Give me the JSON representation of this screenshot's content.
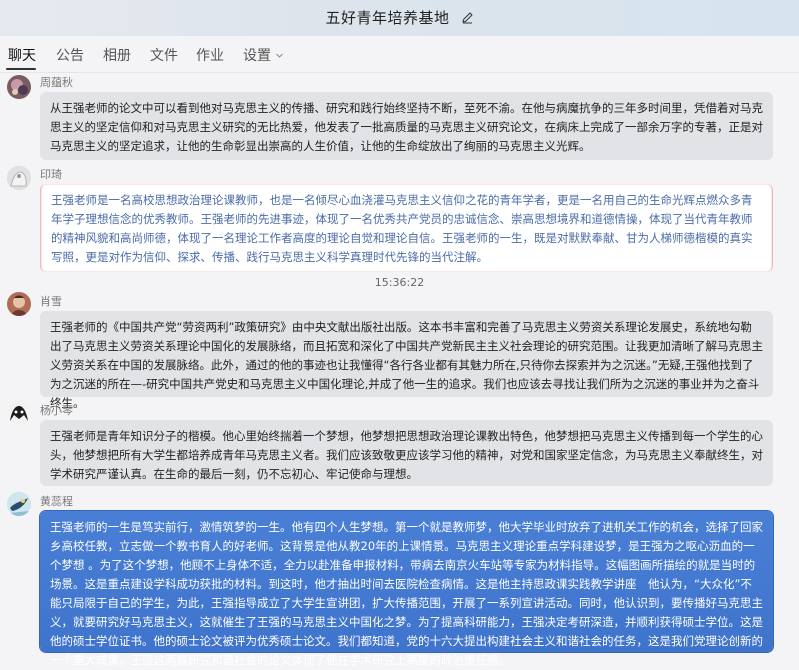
{
  "header": {
    "title": "五好青年培养基地"
  },
  "tabs": [
    {
      "label": "聊天",
      "active": true
    },
    {
      "label": "公告",
      "active": false
    },
    {
      "label": "相册",
      "active": false
    },
    {
      "label": "文件",
      "active": false
    },
    {
      "label": "作业",
      "active": false
    },
    {
      "label": "设置",
      "active": false
    }
  ],
  "messages": [
    {
      "name": "周蕴秋",
      "text": "从王强老师的论文中可以看到他对马克思主义的传播、研究和践行始终坚持不断，至死不渝。在他与病魔抗争的三年多时间里，凭借着对马克思主义的坚定信仰和对马克思主义研究的无比热爱，他发表了一批高质量的马克思主义研究论文，在病床上完成了一部余万字的专著，正是对马克思主义的坚定追求，让他的生命彰显出崇高的人生价值，让他的生命绽放出了绚丽的马克思主义光辉。"
    },
    {
      "name": "印琦",
      "text": "王强老师是一名高校思想政治理论课教师，也是一名倾尽心血浇灌马克思主义信仰之花的青年学者，更是一名用自己的生命光辉点燃众多青年学子理想信念的优秀教师。王强老师的先进事迹，体现了一名优秀共产党员的忠诚信念、崇高思想境界和道德情操，体现了当代青年教师的精神风貌和高尚师德，体现了一名理论工作者高度的理论自觉和理论自信。王强老师的一生，既是对默默奉献、甘为人梯师德楷模的真实写照，更是对作为信仰、探求、传播、践行马克思主义科学真理时代先锋的当代注解。"
    },
    {
      "timestamp": "15:36:22"
    },
    {
      "name": "肖雪",
      "text": "王强老师的《中国共产党“劳资两利”政策研究》由中央文献出版社出版。这本书丰富和完善了马克思主义劳资关系理论发展史，系统地勾勒出了马克思主义劳资关系理论中国化的发展脉络，而且拓宽和深化了中国共产党新民主主义社会理论的研究范围。让我更加清晰了解马克思主义劳资关系在中国的发展脉络。此外，通过的他的事迹也让我懂得“各行各业都有其魅力所在,只待你去探索并为之沉迷。”无疑,王强他找到了为之沉迷的所在—-研究中国共产党史和马克思主义中国化理论,并成了他一生的追求。我们也应该去寻找让我们所为之沉迷的事业并为之奋斗终生。"
    },
    {
      "name": "杨小琴",
      "text": "王强老师是青年知识分子的楷模。他心里始终揣着一个梦想，他梦想把思想政治理论课教出特色，他梦想把马克思主义传播到每一个学生的心头，他梦想把所有大学生都培养成青年马克思主义者。我们应该致敬更应该学习他的精神，对党和国家坚定信念，为马克思主义奉献终生，对学术研究严谨认真。在生命的最后一刻，仍不忘初心、牢记使命与理想。"
    },
    {
      "name": "黄蕊程",
      "text": "王强老师的一生是笃实前行，激情筑梦的一生。他有四个人生梦想。第一个就是教师梦，他大学毕业时放弃了进机关工作的机会，选择了回家乡高校任教，立志做一个教书育人的好老师。这背景是他从教20年的上课情景。马克思主义理论重点学科建设梦，是王强为之呕心沥血的一个梦想 。为了这个梦想，他顾不上身体不适，全力以赴准备申报材料，带病去南京火车站等专家为材料指导。这幅图画所描绘的就是当时的场景。这是重点建设学科成功获批的材料。到这时，他才抽出时间去医院检查病情。这是他主持思政课实践教学讲座　他认为，“大众化”不能只局限于自己的学生，为此，王强指导成立了大学生宣讲团，扩大传播范围，开展了一系列宣讲活动。同时，他认识到，要传播好马克思主义，就要研究好马克思主义，这就催生了王强的马克思主义中国化之梦。为了提高科研能力，王强决定考研深造，并顺利获得硕士学位。这是他的硕士学位证书。他的硕士论文被评为优秀硕士论文。我们都知道，党的十六大提出构建社会主义和谐社会的任务，这是我们党理论创新的一个重大成果。王强这两篇研究和谐社会的论文体现了他在学术研究上高度的政治责任感。"
    }
  ]
}
